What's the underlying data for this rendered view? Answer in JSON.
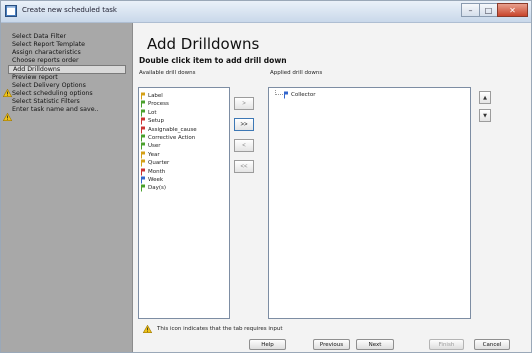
{
  "window": {
    "title": "Create new scheduled task"
  },
  "sidebar": {
    "items": [
      {
        "label": "Select Data Filter",
        "warning": false,
        "active": false
      },
      {
        "label": "Select Report Template",
        "warning": false,
        "active": false
      },
      {
        "label": "Assign characteristics",
        "warning": false,
        "active": false
      },
      {
        "label": "Choose reports order",
        "warning": false,
        "active": false
      },
      {
        "label": "Add Drilldowns",
        "warning": false,
        "active": true
      },
      {
        "label": "Preview report",
        "warning": false,
        "active": false
      },
      {
        "label": "Select Delivery Options",
        "warning": true,
        "active": false
      },
      {
        "label": "Select scheduling options",
        "warning": false,
        "active": false
      },
      {
        "label": "Select Statistic Filters",
        "warning": false,
        "active": false
      },
      {
        "label": "Enter task name and save..",
        "warning": true,
        "active": false
      }
    ]
  },
  "main": {
    "title": "Add Drilldowns",
    "subtitle": "Double click item to add drill down",
    "available_label": "Available drill downs",
    "applied_label": "Applied drill downs",
    "available": [
      {
        "label": "Label",
        "color": "#d4a017"
      },
      {
        "label": "Process",
        "color": "#4aa02c"
      },
      {
        "label": "Lot",
        "color": "#4aa02c"
      },
      {
        "label": "Setup",
        "color": "#cc3333"
      },
      {
        "label": "Assignable_cause",
        "color": "#cc3333"
      },
      {
        "label": "Corrective Action",
        "color": "#4aa02c"
      },
      {
        "label": "User",
        "color": "#4aa02c"
      },
      {
        "label": "Year",
        "color": "#d4a017"
      },
      {
        "label": "Quarter",
        "color": "#d4a017"
      },
      {
        "label": "Month",
        "color": "#cc3333"
      },
      {
        "label": "Week",
        "color": "#3366cc"
      },
      {
        "label": "Day(s)",
        "color": "#4aa02c"
      }
    ],
    "applied": [
      {
        "label": "Collector",
        "color": "#3366cc"
      }
    ],
    "move": {
      "add_one": ">",
      "add_all": ">>",
      "remove_one": "<",
      "remove_all": "<<"
    },
    "order": {
      "up": "▲",
      "down": "▼"
    },
    "info_text": "This icon indicates that the tab requires input"
  },
  "footer": {
    "help": "Help",
    "previous": "Previous",
    "next": "Next",
    "finish": "Finish",
    "cancel": "Cancel"
  },
  "icons": {
    "warning": "warning-triangle-icon",
    "drill_pin": "pin-icon",
    "app": "task-window-icon"
  }
}
